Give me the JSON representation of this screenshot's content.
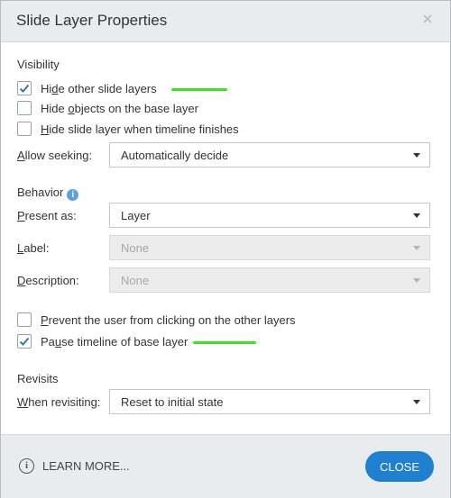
{
  "dialog": {
    "title": "Slide Layer Properties",
    "close_icon": "close-icon"
  },
  "visibility": {
    "heading": "Visibility",
    "hide_other_layers": {
      "label_pre": "Hi",
      "label_ul": "d",
      "label_post": "e other slide layers",
      "checked": true
    },
    "hide_objects_base": {
      "label_pre": "Hide ",
      "label_ul": "o",
      "label_post": "bjects on the base layer",
      "checked": false
    },
    "hide_when_finishes": {
      "label_pre": "",
      "label_ul": "H",
      "label_post": "ide slide layer when timeline finishes",
      "checked": false
    },
    "allow_seeking": {
      "label_pre": "",
      "label_ul": "A",
      "label_post": "llow seeking:",
      "value": "Automatically decide"
    }
  },
  "behavior": {
    "heading": "Behavior",
    "info_icon": "info-icon",
    "present_as": {
      "label_pre": "",
      "label_ul": "P",
      "label_post": "resent as:",
      "value": "Layer"
    },
    "label_field": {
      "label_pre": "",
      "label_ul": "L",
      "label_post": "abel:",
      "value": "None",
      "disabled": true
    },
    "description_field": {
      "label_pre": "",
      "label_ul": "D",
      "label_post": "escription:",
      "value": "None",
      "disabled": true
    },
    "prevent_clicking": {
      "label_pre": "",
      "label_ul": "P",
      "label_post": "revent the user from clicking on the other layers",
      "checked": false
    },
    "pause_timeline": {
      "label_pre": "Pa",
      "label_ul": "u",
      "label_post": "se timeline of base layer",
      "checked": true
    }
  },
  "revisits": {
    "heading": "Revisits",
    "when_revisiting": {
      "label_pre": "",
      "label_ul": "W",
      "label_post": "hen revisiting:",
      "value": "Reset to initial state"
    }
  },
  "footer": {
    "learn_more": "LEARN MORE...",
    "close_button": "CLOSE"
  },
  "colors": {
    "accent": "#1f7fd0",
    "highlight_mark": "#39e61e",
    "checkmark": "#1f6fb8"
  }
}
